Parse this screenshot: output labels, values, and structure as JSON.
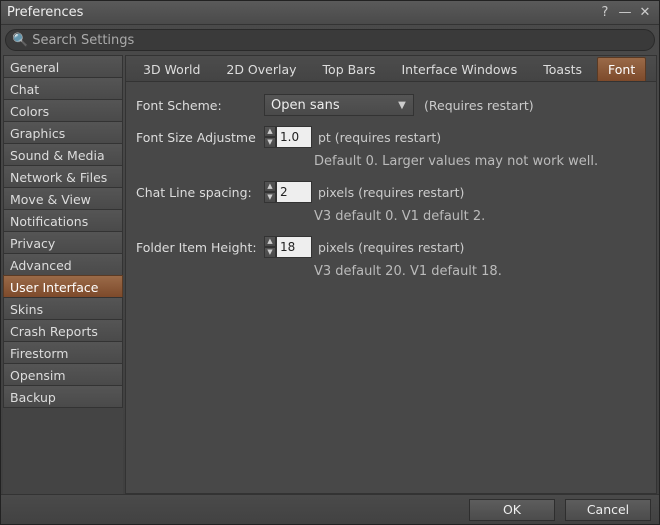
{
  "title": "Preferences",
  "search_placeholder": "Search Settings",
  "sidebar": {
    "items": [
      {
        "label": "General"
      },
      {
        "label": "Chat"
      },
      {
        "label": "Colors"
      },
      {
        "label": "Graphics"
      },
      {
        "label": "Sound & Media"
      },
      {
        "label": "Network & Files"
      },
      {
        "label": "Move & View"
      },
      {
        "label": "Notifications"
      },
      {
        "label": "Privacy"
      },
      {
        "label": "Advanced"
      },
      {
        "label": "User Interface"
      },
      {
        "label": "Skins"
      },
      {
        "label": "Crash Reports"
      },
      {
        "label": "Firestorm"
      },
      {
        "label": "Opensim"
      },
      {
        "label": "Backup"
      }
    ],
    "active_index": 10
  },
  "tabs": {
    "items": [
      {
        "label": "3D World"
      },
      {
        "label": "2D Overlay"
      },
      {
        "label": "Top Bars"
      },
      {
        "label": "Interface Windows"
      },
      {
        "label": "Toasts"
      },
      {
        "label": "Font"
      }
    ],
    "active_index": 5
  },
  "font_scheme": {
    "label": "Font Scheme:",
    "value": "Open sans",
    "requires": "(Requires restart)"
  },
  "font_size": {
    "label": "Font Size Adjustme",
    "value": "1.0",
    "unit": "pt (requires restart)",
    "help": "Default 0. Larger values may not work well."
  },
  "chat_spacing": {
    "label": "Chat Line spacing:",
    "value": "2",
    "unit": "pixels (requires restart)",
    "help": "V3 default 0. V1 default 2."
  },
  "folder_height": {
    "label": "Folder Item Height:",
    "value": "18",
    "unit": "pixels (requires restart)",
    "help": "V3 default 20. V1 default 18."
  },
  "buttons": {
    "ok": "OK",
    "cancel": "Cancel"
  }
}
